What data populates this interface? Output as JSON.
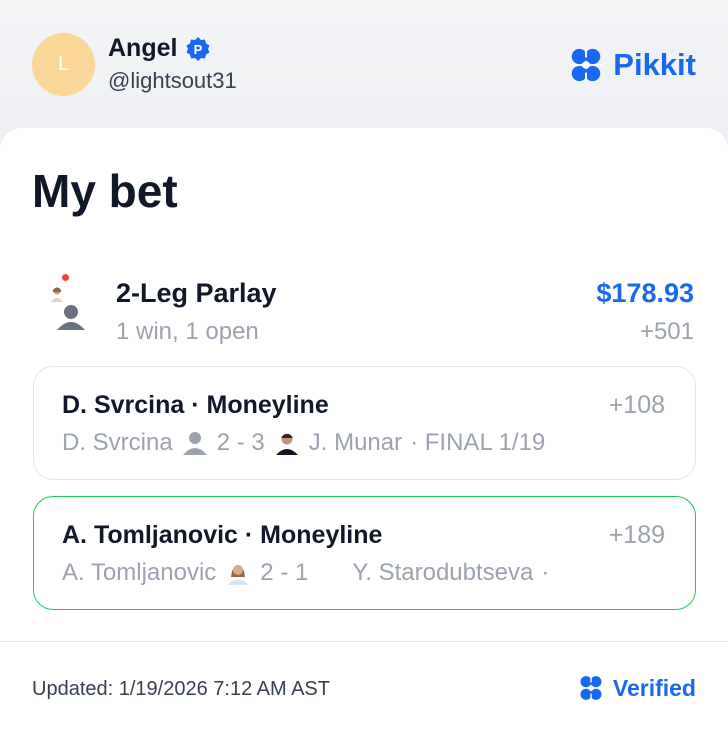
{
  "user": {
    "initial": "L",
    "name": "Angel",
    "handle": "@lightsout31",
    "badge": "P"
  },
  "brand": {
    "name": "Pikkit",
    "color": "#1868f2"
  },
  "card": {
    "title": "My bet",
    "parlay": {
      "title": "2-Leg Parlay",
      "status": "1 win, 1 open",
      "payout": "$178.93",
      "odds": "+501"
    },
    "legs": [
      {
        "title": "D. Svrcina · Moneyline",
        "odds": "+108",
        "player1": "D. Svrcina",
        "score": "2 - 3",
        "player2": "J. Munar",
        "status": "· FINAL 1/19",
        "state": "open"
      },
      {
        "title": "A. Tomljanovic · Moneyline",
        "odds": "+189",
        "player1": "A. Tomljanovic",
        "score": "2 - 1",
        "player2": "Y. Starodubtseva",
        "status": "·",
        "state": "won"
      }
    ],
    "footer": {
      "updated": "Updated: 1/19/2026 7:12 AM AST",
      "verified": "Verified"
    }
  }
}
